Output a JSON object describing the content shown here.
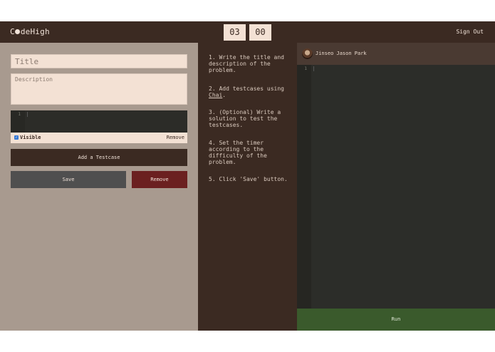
{
  "header": {
    "brand_prefix": "C",
    "brand_suffix": "deHigh",
    "timer_minutes": "03",
    "timer_seconds": "00",
    "signout_label": "Sign Out"
  },
  "editor": {
    "title_placeholder": "Title",
    "description_placeholder": "Description",
    "testcase": {
      "line_number": "1",
      "visible_label": "Visible",
      "visible_checked": true,
      "remove_label": "Remove"
    },
    "add_testcase_label": "Add a Testcase",
    "save_label": "Save",
    "remove_label": "Remove"
  },
  "instructions": {
    "step1": "1. Write the title and description of the problem.",
    "step2_prefix": "2. Add testcases using ",
    "step2_link": "Chai",
    "step2_suffix": ".",
    "step3": "3. (Optional) Write a solution to test the testcases.",
    "step4": "4. Set the timer according to the difficulty of the problem.",
    "step5": "5. Click 'Save' button."
  },
  "solution": {
    "user_name": "Jinseo Jason Park",
    "line_number": "1",
    "run_label": "Run"
  },
  "colors": {
    "header_bg": "#3b2a22",
    "panel_bg": "#a89a8f",
    "input_bg": "#f3e1d4",
    "code_bg": "#2c2d29",
    "remove_red": "#6b2020",
    "run_green": "#3a5a2c"
  }
}
